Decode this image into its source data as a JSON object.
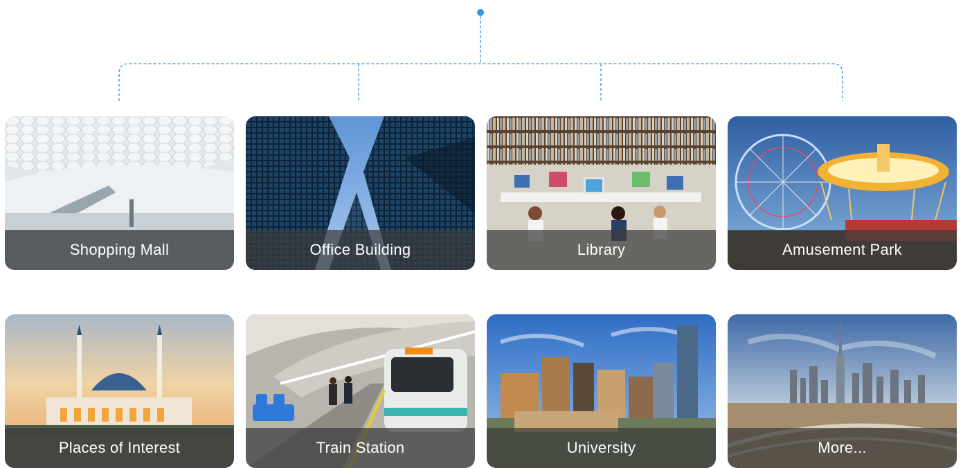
{
  "accent_color": "#2f95e6",
  "cards": [
    {
      "label": "Shopping Mall",
      "image": "shopping-mall-photo"
    },
    {
      "label": "Office Building",
      "image": "office-building-photo"
    },
    {
      "label": "Library",
      "image": "library-photo"
    },
    {
      "label": "Amusement Park",
      "image": "amusement-park-photo"
    },
    {
      "label": "Places of Interest",
      "image": "mosque-photo"
    },
    {
      "label": "Train Station",
      "image": "train-station-photo"
    },
    {
      "label": "University",
      "image": "city-skyline-photo"
    },
    {
      "label": "More...",
      "image": "dubai-skyline-photo"
    }
  ]
}
